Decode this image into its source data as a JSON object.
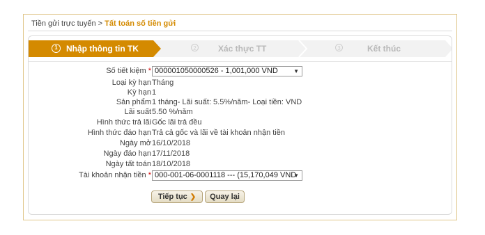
{
  "breadcrumb": {
    "parent": "Tiền gửi trực tuyến",
    "separator": ">",
    "current": "Tất toán số tiền gửi"
  },
  "steps": [
    {
      "num": "1",
      "label": "Nhập thông tin TK",
      "active": true
    },
    {
      "num": "2",
      "label": "Xác thực TT",
      "active": false
    },
    {
      "num": "3",
      "label": "Kết thúc",
      "active": false
    }
  ],
  "form": {
    "so_tiet_kiem": {
      "label": "Số tiết kiệm",
      "required": "*",
      "value": "000001050000526 - 1,001,000 VND"
    },
    "loai_ky_han": {
      "label": "Loại kỳ hạn",
      "value": "Tháng"
    },
    "ky_han": {
      "label": "Kỳ hạn",
      "value": "1"
    },
    "san_pham": {
      "label": "Sản phẩm",
      "value": "1 tháng- Lãi suất: 5.5%/năm- Loại tiền: VND"
    },
    "lai_suat": {
      "label": "Lãi suất",
      "value": "5.50 %/năm"
    },
    "hinh_thuc_tra_lai": {
      "label": "Hình thức trả lãi",
      "value": "Gốc lãi trả đều"
    },
    "hinh_thuc_dao_han": {
      "label": "Hình thức đáo hạn",
      "value": "Trả cả gốc và lãi về tài khoản nhận tiền"
    },
    "ngay_mo": {
      "label": "Ngày mở",
      "value": "16/10/2018"
    },
    "ngay_dao_han": {
      "label": "Ngày đáo hạn",
      "value": "17/11/2018"
    },
    "ngay_tat_toan": {
      "label": "Ngày tất toán",
      "value": "18/10/2018"
    },
    "tai_khoan_nhan_tien": {
      "label": "Tài khoản nhận tiền",
      "required": "*",
      "value": "000-001-06-0001118 --- (15,170,049 VND"
    }
  },
  "buttons": {
    "continue": "Tiếp tục",
    "back": "Quay lại"
  },
  "colors": {
    "active_step": "#d48a00",
    "accent": "#d48a00",
    "border": "#e0c68a"
  }
}
